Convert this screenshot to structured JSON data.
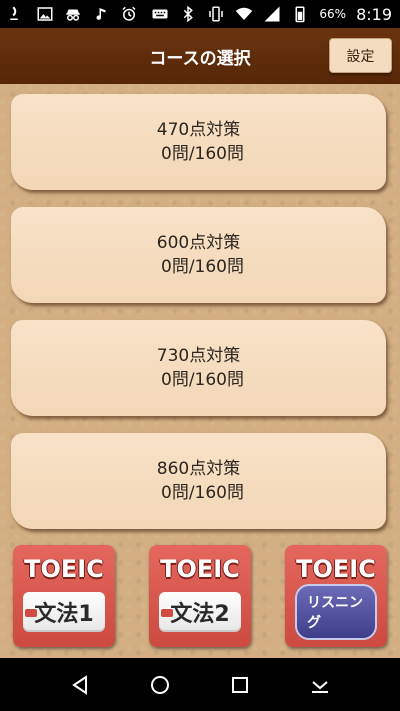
{
  "status_bar": {
    "battery_percent": "66%",
    "time": "8:19",
    "left_icons": [
      "wifi-calling-icon",
      "image-icon",
      "incognito-icon",
      "music-icon",
      "alarm-icon"
    ],
    "right_icons": [
      "keyboard-icon",
      "bluetooth-icon",
      "vibrate-icon",
      "wifi-icon",
      "signal-icon",
      "battery-icon"
    ]
  },
  "header": {
    "title": "コースの選択",
    "settings_label": "設定",
    "background_color": "#5f2c0b"
  },
  "courses": [
    {
      "name": "470点対策",
      "progress": "0問/160問"
    },
    {
      "name": "600点対策",
      "progress": "0問/160問"
    },
    {
      "name": "730点対策",
      "progress": "0問/160問"
    },
    {
      "name": "860点対策",
      "progress": "0問/160問"
    }
  ],
  "apps": [
    {
      "logo": "TOEIC",
      "sub": "文法1"
    },
    {
      "logo": "TOEIC",
      "sub": "文法2"
    },
    {
      "logo": "TOEIC",
      "sub": "リスニング"
    }
  ],
  "nav": {
    "icons": [
      "back-icon",
      "home-icon",
      "recents-icon",
      "hide-keyboard-icon"
    ]
  }
}
